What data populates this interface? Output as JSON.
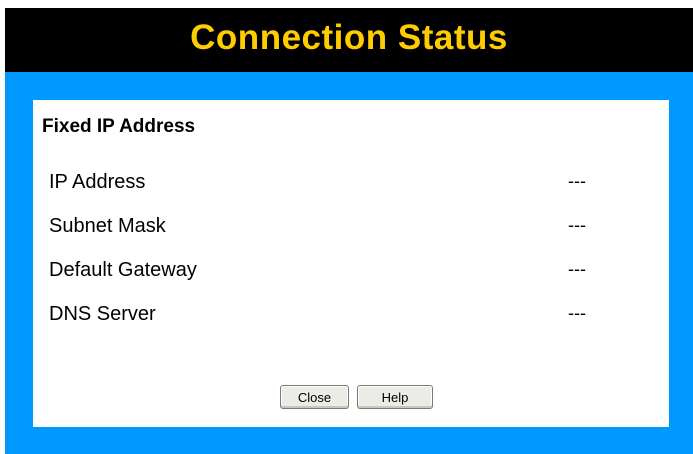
{
  "header": {
    "title": "Connection Status",
    "title_color": "#ffcc00",
    "bar_color": "#000000",
    "frame_color": "#0099ff"
  },
  "panel": {
    "heading": "Fixed IP Address",
    "rows": [
      {
        "label": "IP Address",
        "value": "---"
      },
      {
        "label": "Subnet Mask",
        "value": "---"
      },
      {
        "label": "Default Gateway",
        "value": "---"
      },
      {
        "label": "DNS Server",
        "value": "---"
      }
    ]
  },
  "buttons": {
    "close_label": "Close",
    "help_label": "Help"
  }
}
